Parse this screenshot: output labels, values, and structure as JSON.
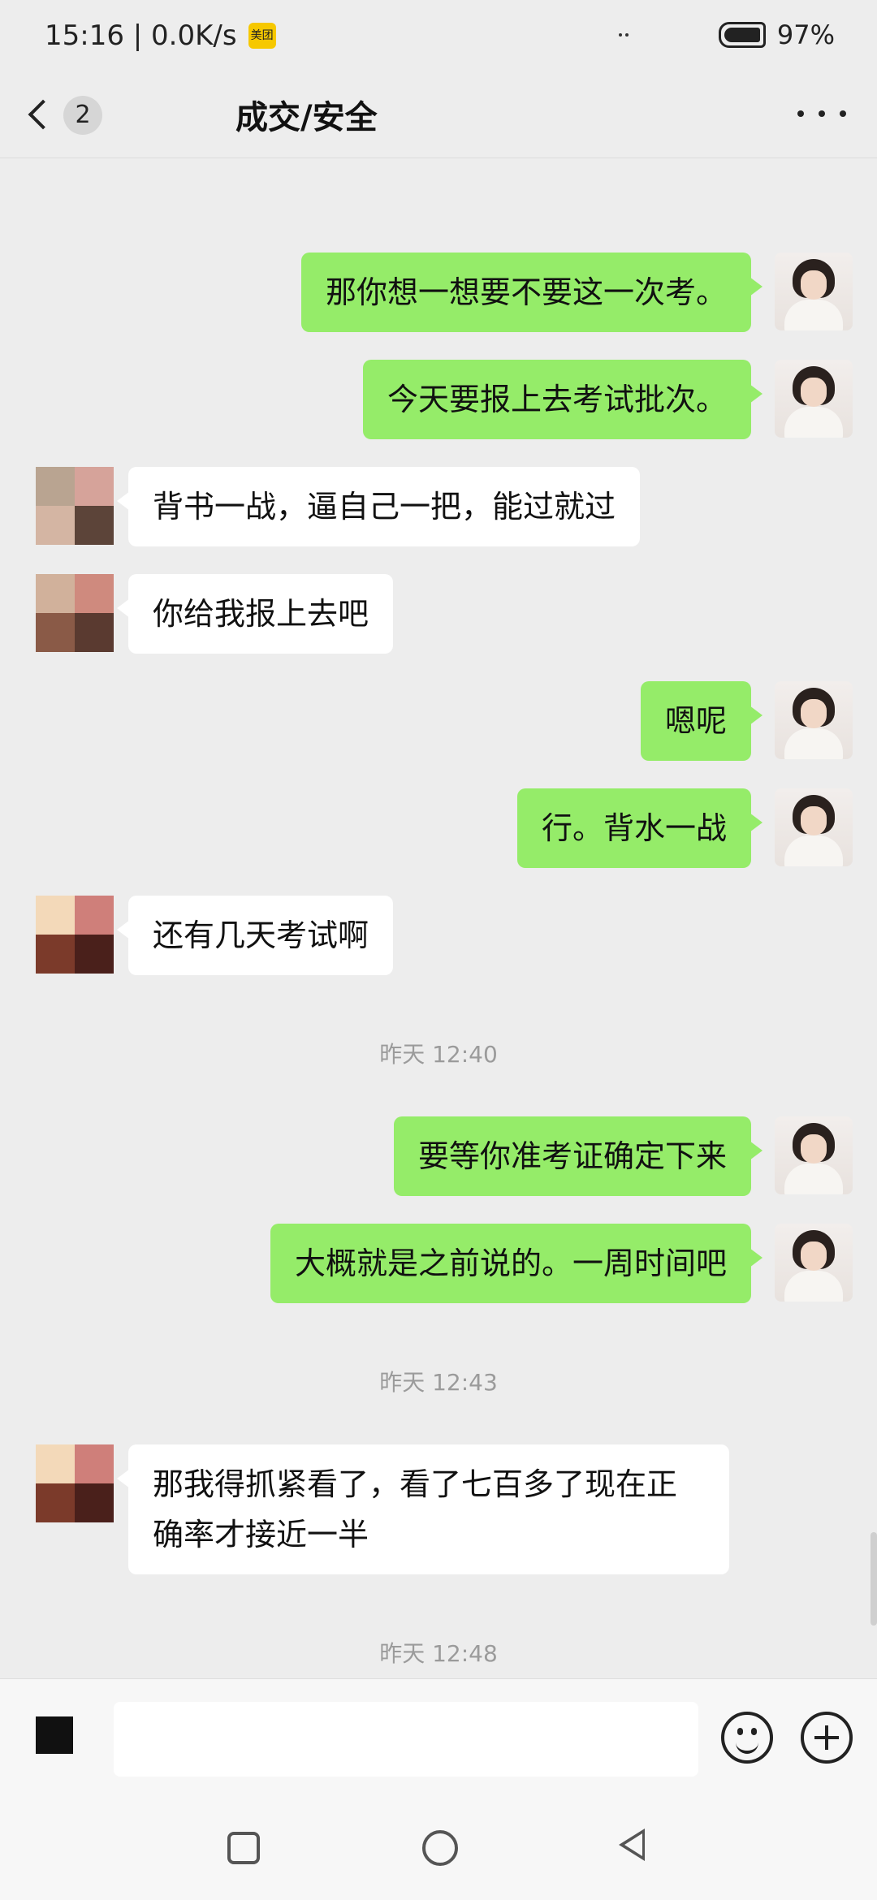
{
  "status_bar": {
    "time_speed": "15:16 | 0.0K/s",
    "app_badge": "美团",
    "battery": "97%"
  },
  "header": {
    "unread_count": "2",
    "title": "成交/安全"
  },
  "messages": [
    {
      "from": "me",
      "text": "那你想一想要不要这一次考。"
    },
    {
      "from": "me",
      "text": "今天要报上去考试批次。"
    },
    {
      "from": "them",
      "text": "背书一战，逼自己一把，能过就过"
    },
    {
      "from": "them",
      "text": "你给我报上去吧"
    },
    {
      "from": "me",
      "text": "嗯呢"
    },
    {
      "from": "me",
      "text": "行。背水一战"
    },
    {
      "from": "them",
      "text": "还有几天考试啊"
    },
    {
      "from": "me",
      "text": "要等你准考证确定下来"
    },
    {
      "from": "me",
      "text": "大概就是之前说的。一周时间吧"
    },
    {
      "from": "them",
      "text": "那我得抓紧看了，看了七百多了现在正确率才接近一半"
    }
  ],
  "timestamps": [
    "昨天 12:40",
    "昨天 12:43",
    "昨天 12:48"
  ],
  "input": {
    "value": "",
    "placeholder": ""
  },
  "colors": {
    "my_bubble": "#95ec69",
    "their_bubble": "#ffffff",
    "background": "#ededed"
  },
  "icons": [
    "back-chevron-icon",
    "more-dots-icon",
    "voice-icon",
    "emoji-icon",
    "plus-icon",
    "recent-apps-icon",
    "home-icon",
    "back-triangle-icon"
  ]
}
